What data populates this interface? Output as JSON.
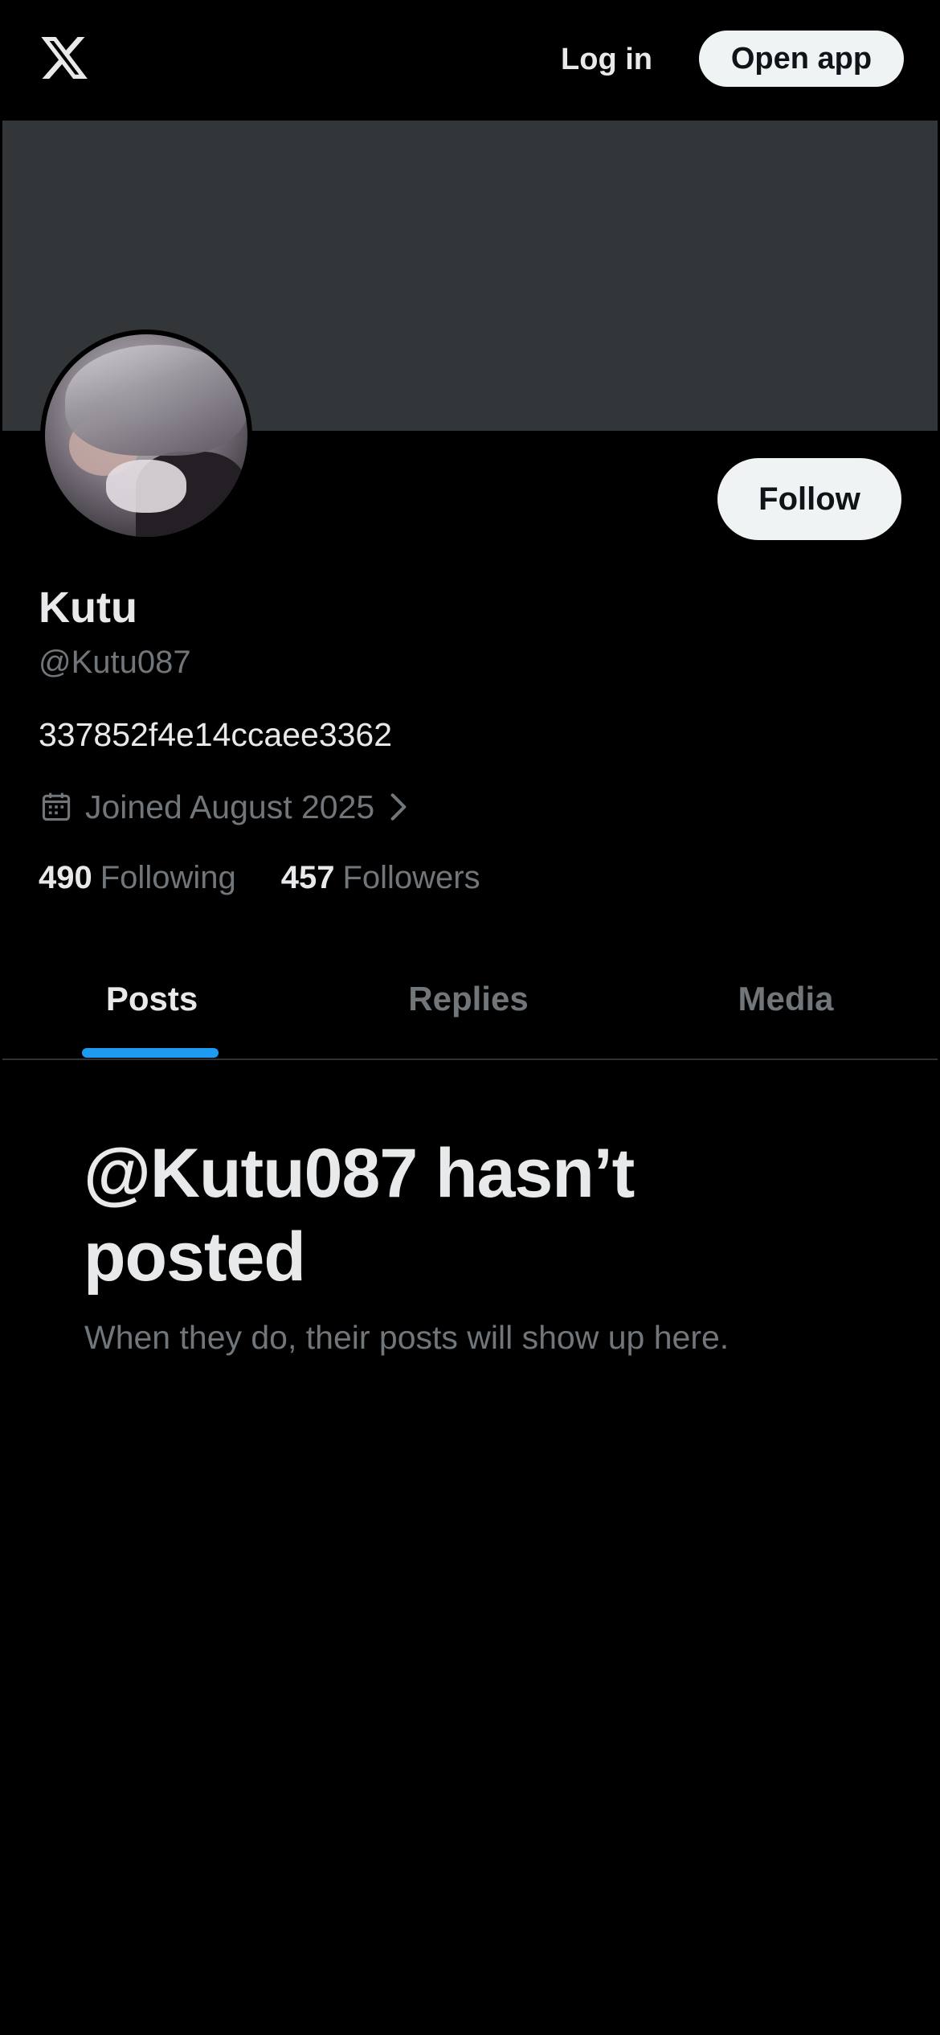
{
  "topbar": {
    "logo_icon": "x-logo-icon",
    "login_label": "Log in",
    "open_app_label": "Open app"
  },
  "profile": {
    "display_name": "Kutu",
    "handle": "@Kutu087",
    "bio": "337852f4e14ccaee3362",
    "joined": "Joined August 2025",
    "joined_icon": "calendar-icon",
    "following_count": "490",
    "following_label": "Following",
    "followers_count": "457",
    "followers_label": "Followers",
    "follow_label": "Follow"
  },
  "tabs": [
    {
      "label": "Posts",
      "active": true
    },
    {
      "label": "Replies",
      "active": false
    },
    {
      "label": "Media",
      "active": false
    }
  ],
  "empty_state": {
    "title": "@Kutu087 hasn’t posted",
    "subtitle": "When they do, their posts will show up here."
  },
  "colors": {
    "background": "#000000",
    "banner": "#333639",
    "accent": "#1d9bf0",
    "secondary_text": "#71767b",
    "primary_text": "#e7e9ea",
    "button_bg": "#eff3f4"
  }
}
